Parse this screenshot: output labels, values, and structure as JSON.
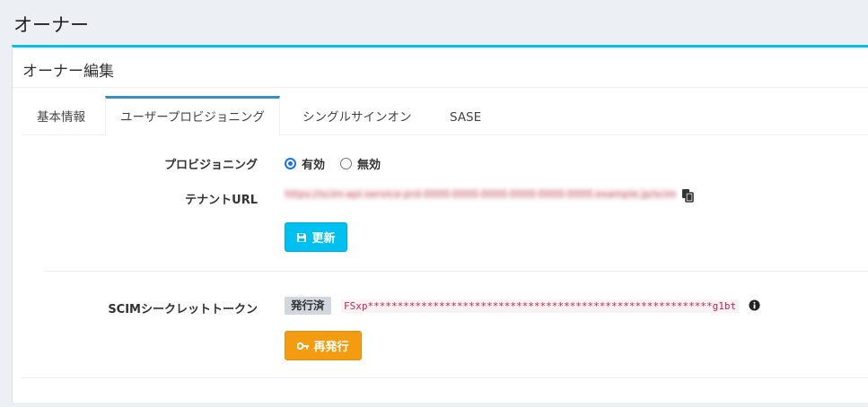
{
  "page": {
    "title": "オーナー"
  },
  "panel": {
    "title": "オーナー編集"
  },
  "tabs": [
    {
      "label": "基本情報",
      "active": false
    },
    {
      "label": "ユーザープロビジョニング",
      "active": true
    },
    {
      "label": "シングルサインオン",
      "active": false
    },
    {
      "label": "SASE",
      "active": false
    }
  ],
  "provisioning": {
    "label": "プロビジョニング",
    "options": [
      {
        "label": "有効",
        "checked": true
      },
      {
        "label": "無効",
        "checked": false
      }
    ]
  },
  "tenant_url": {
    "label": "テナントURL",
    "value": "https://scim-api-service-prd-0000-0000-0000-0000-0000-0000.example.jp/scim/v2"
  },
  "update_button": {
    "label": "更新",
    "icon": "floppy-disk-icon"
  },
  "scim_token": {
    "label": "SCIMシークレットトークン",
    "status": "発行済",
    "value": "FSxp**********************************************************g1bt",
    "info_icon": "info-circle-icon"
  },
  "reissue_button": {
    "label": "再発行",
    "icon": "key-icon"
  },
  "colors": {
    "accent": "#00c0ef",
    "tab_active": "#3c8dbc",
    "warning": "#f39c12",
    "token_text": "#c7254e"
  }
}
